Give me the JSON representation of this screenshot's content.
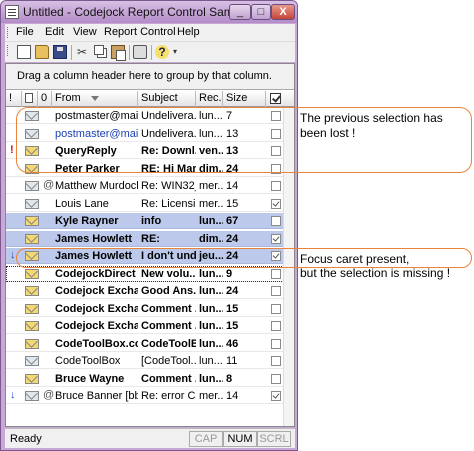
{
  "window": {
    "title": "Untitled - Codejock Report Control Sample",
    "buttons": {
      "minimize": "_",
      "maximize": "□",
      "close": "X"
    }
  },
  "menu": [
    "File",
    "Edit",
    "View",
    "Report Control",
    "Help"
  ],
  "toolbar_icons": [
    "new-icon",
    "open-icon",
    "save-icon",
    "cut-icon",
    "copy-icon",
    "paste-icon",
    "print-icon",
    "help-icon"
  ],
  "group_box_text": "Drag a column header here to group by that column.",
  "columns": {
    "importance": "!",
    "icon": "",
    "attachment": "0",
    "from": "From",
    "subject": "Subject",
    "received": "Rec...",
    "size": "Size"
  },
  "rows": [
    {
      "imp": "",
      "icon": "read",
      "att": "",
      "from": "postmaster@mail...",
      "subject": "Undelivera...",
      "recv": "lun...",
      "size": "7",
      "checked": false,
      "bold": false,
      "sel": false,
      "link": false
    },
    {
      "imp": "",
      "icon": "read",
      "att": "",
      "from": "postmaster@mail...",
      "subject": "Undelivera...",
      "recv": "lun...",
      "size": "13",
      "checked": false,
      "bold": false,
      "sel": false,
      "link": true
    },
    {
      "imp": "!",
      "icon": "unread",
      "att": "",
      "from": "QueryReply",
      "subject": "Re: Downl...",
      "recv": "ven...",
      "size": "13",
      "checked": false,
      "bold": true,
      "sel": false,
      "link": false
    },
    {
      "imp": "",
      "icon": "unread",
      "att": "",
      "from": "Peter Parker",
      "subject": "RE: Hi Mar...",
      "recv": "dim...",
      "size": "24",
      "checked": false,
      "bold": true,
      "sel": false,
      "link": false
    },
    {
      "imp": "",
      "icon": "read",
      "att": "@",
      "from": "Matthew Murdock",
      "subject": "Re: WIN32_...",
      "recv": "mer...",
      "size": "14",
      "checked": false,
      "bold": false,
      "sel": false,
      "link": false
    },
    {
      "imp": "",
      "icon": "read",
      "att": "",
      "from": "Louis Lane",
      "subject": "Re: Licensin...",
      "recv": "mer...",
      "size": "15",
      "checked": true,
      "bold": false,
      "sel": false,
      "link": false
    },
    {
      "imp": "",
      "icon": "unread",
      "att": "",
      "from": "Kyle Rayner",
      "subject": "info",
      "recv": "lun...",
      "size": "67",
      "checked": false,
      "bold": true,
      "sel": true,
      "link": false
    },
    {
      "imp": "",
      "icon": "unread",
      "att": "",
      "from": "James Howlett",
      "subject": "RE:",
      "recv": "dim...",
      "size": "24",
      "checked": true,
      "bold": true,
      "sel": true,
      "link": false
    },
    {
      "imp": "↓",
      "icon": "unread",
      "att": "",
      "from": "James Howlett",
      "subject": "I don't und...",
      "recv": "jeu...",
      "size": "24",
      "checked": true,
      "bold": true,
      "sel": true,
      "link": false
    },
    {
      "imp": "",
      "icon": "unread",
      "att": "",
      "from": "CodejockDirect",
      "subject": "New volu...",
      "recv": "lun...",
      "size": "9",
      "checked": false,
      "bold": true,
      "sel": false,
      "link": false,
      "focus": true
    },
    {
      "imp": "",
      "icon": "unread",
      "att": "",
      "from": "Codejock Exchan...",
      "subject": "Good Ans...",
      "recv": "lun...",
      "size": "24",
      "checked": false,
      "bold": true,
      "sel": false,
      "link": false
    },
    {
      "imp": "",
      "icon": "unread",
      "att": "",
      "from": "Codejock Exchan...",
      "subject": "Comment ...",
      "recv": "lun...",
      "size": "15",
      "checked": false,
      "bold": true,
      "sel": false,
      "link": false
    },
    {
      "imp": "",
      "icon": "unread",
      "att": "",
      "from": "Codejock Exchan...",
      "subject": "Comment ...",
      "recv": "lun...",
      "size": "15",
      "checked": false,
      "bold": true,
      "sel": false,
      "link": false
    },
    {
      "imp": "",
      "icon": "unread",
      "att": "",
      "from": "CodeToolBox.co...",
      "subject": "CodeToolB...",
      "recv": "lun...",
      "size": "46",
      "checked": false,
      "bold": true,
      "sel": false,
      "link": false
    },
    {
      "imp": "",
      "icon": "read",
      "att": "",
      "from": "CodeToolBox",
      "subject": "[CodeTool...",
      "recv": "lun...",
      "size": "11",
      "checked": false,
      "bold": false,
      "sel": false,
      "link": false
    },
    {
      "imp": "",
      "icon": "unread",
      "att": "",
      "from": "Bruce Wayne",
      "subject": "Comment ...",
      "recv": "lun...",
      "size": "8",
      "checked": false,
      "bold": true,
      "sel": false,
      "link": false
    },
    {
      "imp": "↓",
      "icon": "read",
      "att": "@",
      "from": "Bruce Banner [bb...",
      "subject": "Re: error C2...",
      "recv": "mer...",
      "size": "14",
      "checked": true,
      "bold": false,
      "sel": false,
      "link": false
    }
  ],
  "status": {
    "text": "Ready",
    "indicators": [
      "CAP",
      "NUM",
      "SCRL"
    ]
  },
  "annotations": {
    "top": [
      "The previous selection has",
      "been lost !"
    ],
    "bottom": [
      "Focus caret present,",
      "but the selection is missing !"
    ]
  },
  "colors": {
    "selection": "#bcc9ea",
    "callout_border": "#e8843a",
    "high_importance": "#d01010",
    "low_importance": "#1a46c8",
    "link": "#1a3fb3"
  }
}
